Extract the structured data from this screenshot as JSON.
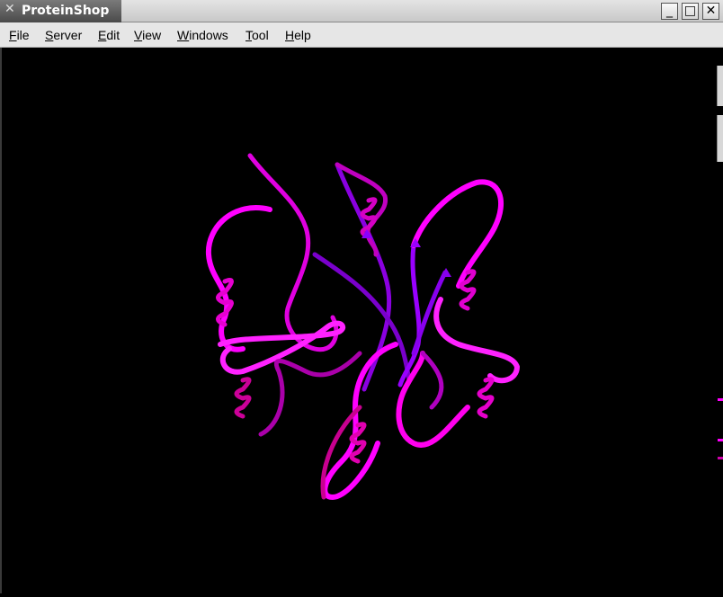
{
  "window": {
    "title": "ProteinShop",
    "controls": {
      "minimize": "_",
      "maximize": "□",
      "close": "✕"
    }
  },
  "menubar": {
    "items": [
      {
        "label": "File",
        "mnemonic": "F",
        "rest": "ile"
      },
      {
        "label": "Server",
        "mnemonic": "S",
        "rest": "erver"
      },
      {
        "label": "Edit",
        "mnemonic": "E",
        "rest": "dit"
      },
      {
        "label": "View",
        "mnemonic": "V",
        "rest": "iew"
      },
      {
        "label": "Windows",
        "mnemonic": "W",
        "rest": "indows"
      },
      {
        "label": "Tool",
        "mnemonic": "T",
        "rest": "ool"
      },
      {
        "label": "Help",
        "mnemonic": "H",
        "rest": "elp"
      }
    ]
  },
  "viewport": {
    "background": "#000000",
    "ribbon_colors": [
      "#ff00ff",
      "#cc00aa",
      "#8800dd",
      "#e00099",
      "#aa0088"
    ]
  }
}
